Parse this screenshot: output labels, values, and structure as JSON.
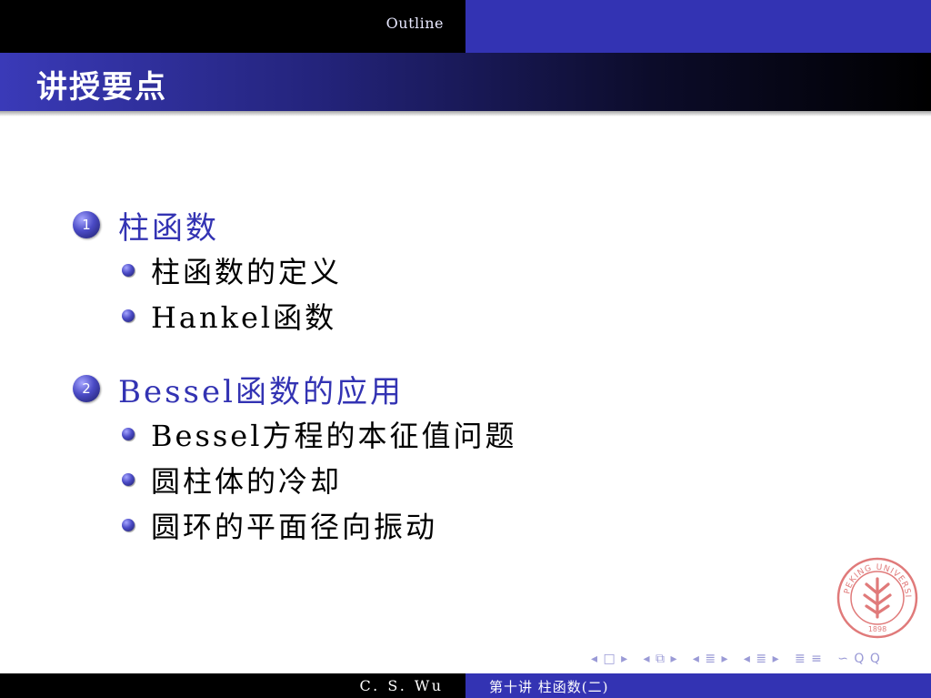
{
  "header": {
    "outline_label": "Outline"
  },
  "frame": {
    "title": "讲授要点"
  },
  "sections": [
    {
      "number": "1",
      "title": "柱函数",
      "items": [
        "柱函数的定义",
        "Hankel函数"
      ]
    },
    {
      "number": "2",
      "title": "Bessel函数的应用",
      "items": [
        "Bessel方程的本征值问题",
        "圆柱体的冷却",
        "圆环的平面径向振动"
      ]
    }
  ],
  "nav": {
    "frame": "◂ □ ▸",
    "subsection": "◂ ⧉ ▸",
    "section": "◂ ≣ ▸",
    "part": "◂ ≣ ▸",
    "align": "≣ ≡",
    "search": "∽ Q Q"
  },
  "footer": {
    "author": "C. S. Wu",
    "lecture": "第十讲  柱函数(二)"
  },
  "colors": {
    "structure": "#3333b3",
    "black": "#000000"
  },
  "logo": {
    "name": "peking-university-seal",
    "text": "PEKING UNIVERSITY",
    "year": "1898"
  }
}
